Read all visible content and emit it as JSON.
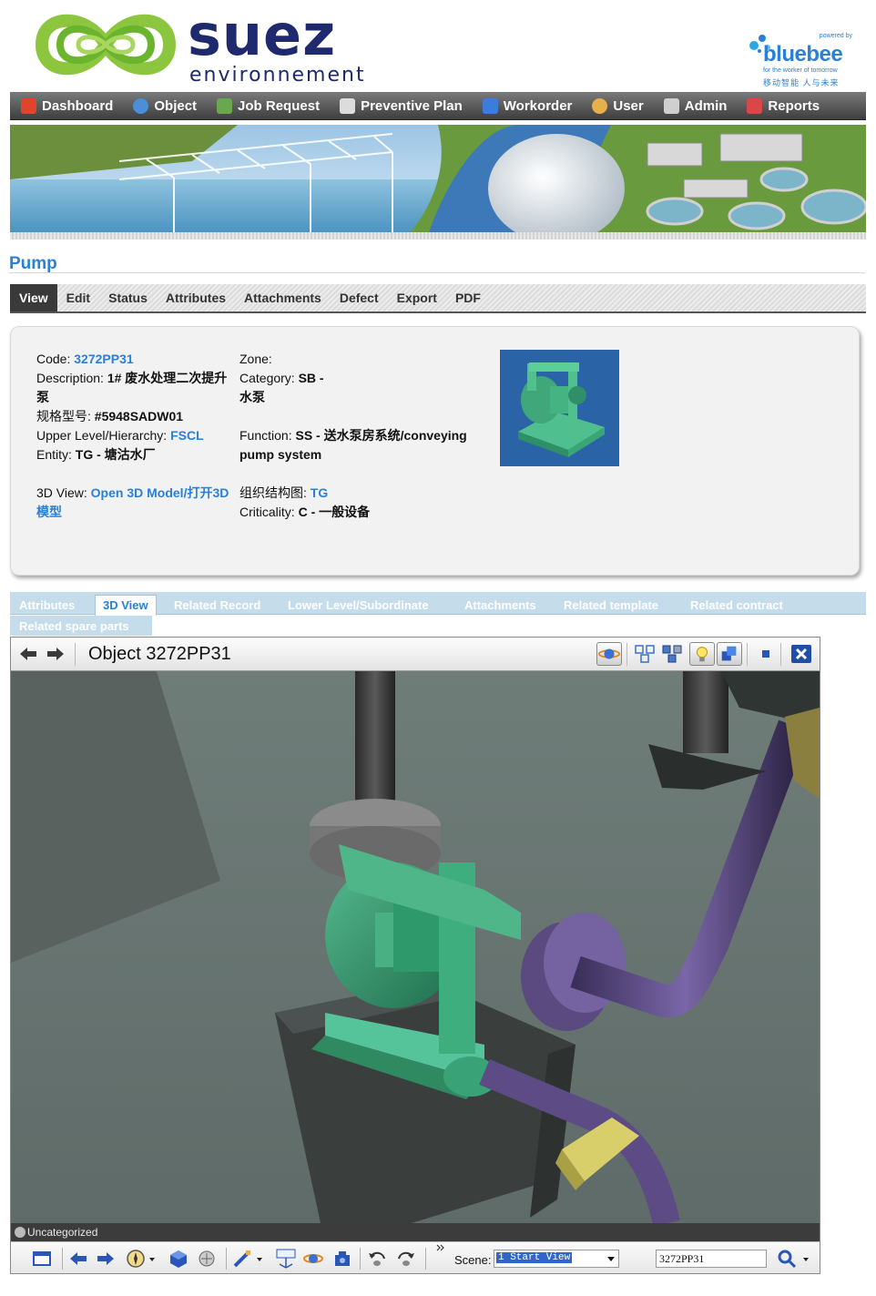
{
  "brand": {
    "name": "suez",
    "sub": "environnement",
    "partner_powered": "powered by",
    "partner_name": "bluebee",
    "partner_tagline": "for the worker of tomorrow",
    "partner_cn": "移动智能 人与未来"
  },
  "nav": {
    "items": [
      {
        "label": "Dashboard",
        "icon": "home-icon",
        "color": "#e0452b"
      },
      {
        "label": "Object",
        "icon": "globe-icon",
        "color": "#4a8fd8"
      },
      {
        "label": "Job Request",
        "icon": "clipboard-icon",
        "color": "#6aa84f"
      },
      {
        "label": "Preventive Plan",
        "icon": "calendar-icon",
        "color": "#dcdcdc"
      },
      {
        "label": "Workorder",
        "icon": "wrench-screen-icon",
        "color": "#3b7dd8"
      },
      {
        "label": "User",
        "icon": "users-icon",
        "color": "#e8b04a"
      },
      {
        "label": "Admin",
        "icon": "tools-icon",
        "color": "#cfcfcf"
      },
      {
        "label": "Reports",
        "icon": "report-icon",
        "color": "#d94848"
      }
    ]
  },
  "page": {
    "title": "Pump"
  },
  "actions": {
    "items": [
      "View",
      "Edit",
      "Status",
      "Attributes",
      "Attachments",
      "Defect",
      "Export",
      "PDF"
    ],
    "active": "View"
  },
  "details": {
    "code_label": "Code:",
    "code_value": "3272PP31",
    "description_label": "Description:",
    "description_value": "1# 废水处理二次提升泵",
    "model_label": "规格型号:",
    "model_value": "#5948SADW01",
    "upper_label": "Upper Level/Hierarchy:",
    "upper_value": "FSCL",
    "entity_label": "Entity:",
    "entity_value": "TG - 塘沽水厂",
    "view3d_label": "3D View:",
    "view3d_value": "Open 3D Model/打开3D模型",
    "zone_label": "Zone:",
    "zone_value": "",
    "category_label": "Category:",
    "category_value": "SB - 水泵",
    "function_label": "Function:",
    "function_value": "SS - 送水泵房系统/conveying pump system",
    "org_label": "组织结构图:",
    "org_value": "TG",
    "criticality_label": "Criticality:",
    "criticality_value": "C - 一般设备"
  },
  "subtabs": {
    "items": [
      "Attributes",
      "3D View",
      "Related Record",
      "Lower Level/Subordinate",
      "Attachments",
      "Related template",
      "Related contract"
    ],
    "row2": [
      "Related spare parts"
    ],
    "active": "3D View"
  },
  "viewer": {
    "title": "Object 3272PP31",
    "category": "Uncategorized",
    "scene_label": "Scene:",
    "scene_value": "1 Start View",
    "search_value": "3272PP31",
    "header_icons": [
      "saturn-icon",
      "cubes-outline-icon",
      "cubes-solid-icon",
      "lightbulb-icon",
      "cube-stack-icon",
      "small-cube-icon",
      "close-icon"
    ],
    "toolbar_icons": [
      "panel-icon",
      "back-arrow-icon",
      "forward-arrow-icon",
      "compass-icon",
      "cube-view-icon",
      "map-icon",
      "measure-icon",
      "xyz-icon",
      "orbit-icon",
      "camera-icon",
      "undo-view-icon",
      "redo-view-icon",
      "search-icon"
    ]
  }
}
